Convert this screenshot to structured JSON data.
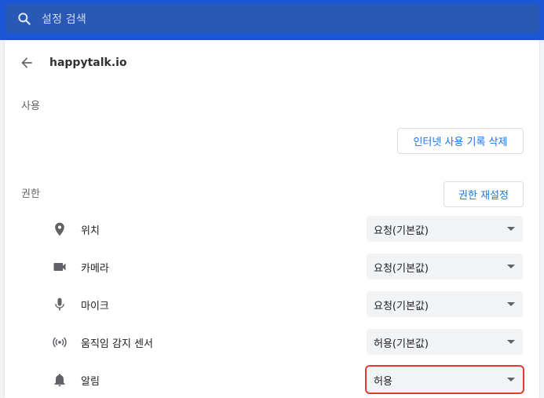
{
  "search": {
    "placeholder": "설정 검색"
  },
  "header": {
    "site": "happytalk.io"
  },
  "usage": {
    "title": "사용",
    "clear_button": "인터넷 사용 기록 삭제"
  },
  "permissions": {
    "title": "권한",
    "reset_button": "권한 재설정",
    "items": [
      {
        "label": "위치",
        "icon": "location-pin-icon",
        "value": "요청(기본값)"
      },
      {
        "label": "카메라",
        "icon": "camera-icon",
        "value": "요청(기본값)"
      },
      {
        "label": "마이크",
        "icon": "microphone-icon",
        "value": "요청(기본값)"
      },
      {
        "label": "움직임 감지 센서",
        "icon": "sensor-icon",
        "value": "허용(기본값)"
      },
      {
        "label": "알림",
        "icon": "bell-icon",
        "value": "허용"
      }
    ]
  },
  "colors": {
    "accent": "#1a73e8",
    "header": "#2a59b5",
    "highlight": "#e53935"
  }
}
